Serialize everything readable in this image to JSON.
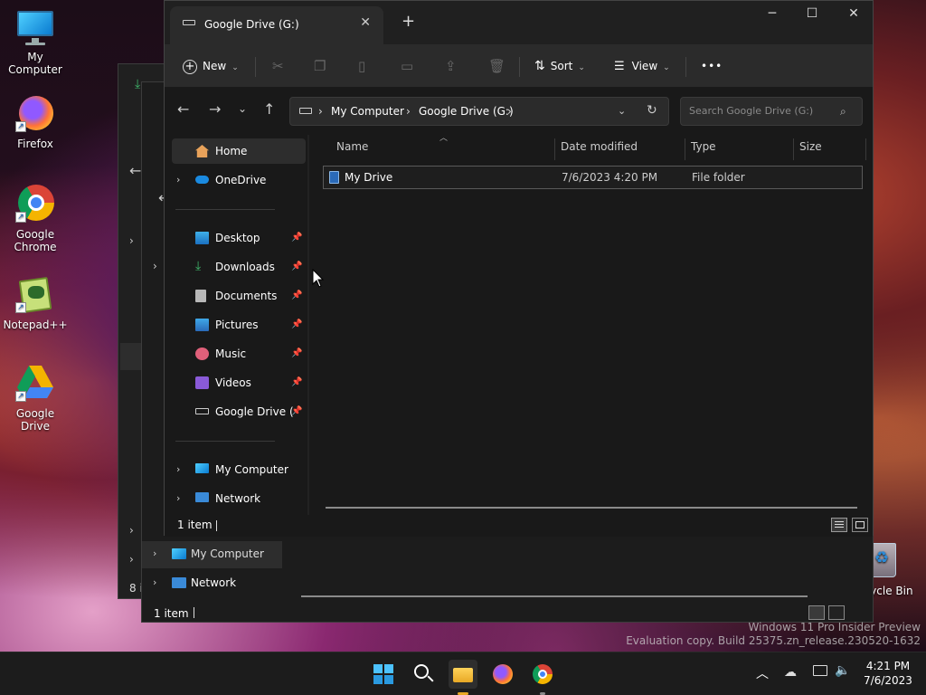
{
  "desktop": {
    "icons": [
      {
        "label": "My Computer"
      },
      {
        "label": "Firefox"
      },
      {
        "label": "Google Chrome"
      },
      {
        "label": "Notepad++"
      },
      {
        "label": "Google Drive"
      },
      {
        "label": "Recycle Bin"
      }
    ]
  },
  "background_window": {
    "nav": [
      {
        "label": "My Computer"
      },
      {
        "label": "Network"
      }
    ],
    "status": "1 item",
    "status_far_left": "8 i"
  },
  "explorer": {
    "tab_title": "Google Drive (G:)",
    "new_tab": "+",
    "toolbar": {
      "new_label": "New",
      "sort_label": "Sort",
      "view_label": "View",
      "more_label": "•••"
    },
    "breadcrumb": [
      "My Computer",
      "Google Drive (G:)"
    ],
    "search_placeholder": "Search Google Drive (G:)",
    "sidebar": {
      "home": "Home",
      "onedrive": "OneDrive",
      "quick_access": [
        {
          "label": "Desktop"
        },
        {
          "label": "Downloads"
        },
        {
          "label": "Documents"
        },
        {
          "label": "Pictures"
        },
        {
          "label": "Music"
        },
        {
          "label": "Videos"
        },
        {
          "label": "Google Drive (G:)"
        }
      ],
      "my_computer": "My Computer",
      "network": "Network"
    },
    "columns": {
      "name": "Name",
      "date": "Date modified",
      "type": "Type",
      "size": "Size"
    },
    "files": [
      {
        "name": "My Drive",
        "date": "7/6/2023 4:20 PM",
        "type": "File folder",
        "size": ""
      }
    ],
    "status": "1 item"
  },
  "watermark": {
    "line1": "Windows 11 Pro Insider Preview",
    "line2": "Evaluation copy. Build 25375.zn_release.230520-1632"
  },
  "taskbar": {
    "time": "4:21 PM",
    "date": "7/6/2023"
  },
  "colors": {
    "accent": "#0078d4",
    "window_bg": "#191919",
    "toolbar_bg": "#2b2b2b"
  }
}
